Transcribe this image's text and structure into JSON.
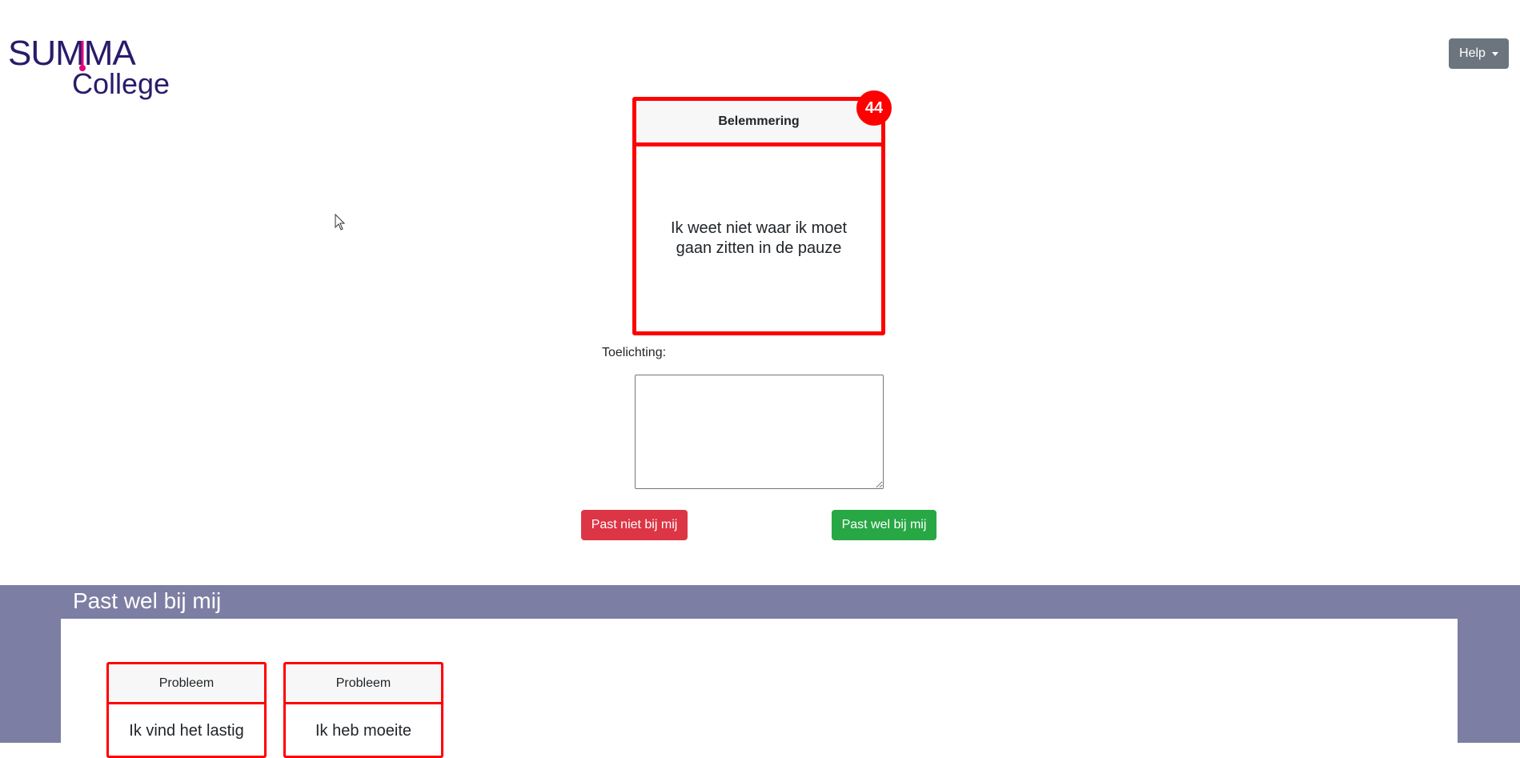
{
  "logo": {
    "line1": "SUMMA",
    "line2": "College"
  },
  "header": {
    "help_label": "Help"
  },
  "current_card": {
    "category": "Belemmering",
    "text": "Ik weet niet waar ik moet gaan zitten in de pauze",
    "badge_count": "44"
  },
  "toelichting": {
    "label": "Toelichting:",
    "value": ""
  },
  "actions": {
    "not_fit": "Past niet bij mij",
    "fit": "Past wel bij mij"
  },
  "fit_section": {
    "title": "Past wel bij mij",
    "cards": [
      {
        "category": "Probleem",
        "text": "Ik vind het lastig"
      },
      {
        "category": "Probleem",
        "text": "Ik heb moeite"
      }
    ]
  },
  "colors": {
    "card_border": "#ff0000",
    "danger": "#dc3545",
    "success": "#28a745",
    "secondary": "#6c757d",
    "section_bg": "#7d7ea3",
    "brand": "#2a1b6b",
    "brand_accent": "#e6007e"
  }
}
